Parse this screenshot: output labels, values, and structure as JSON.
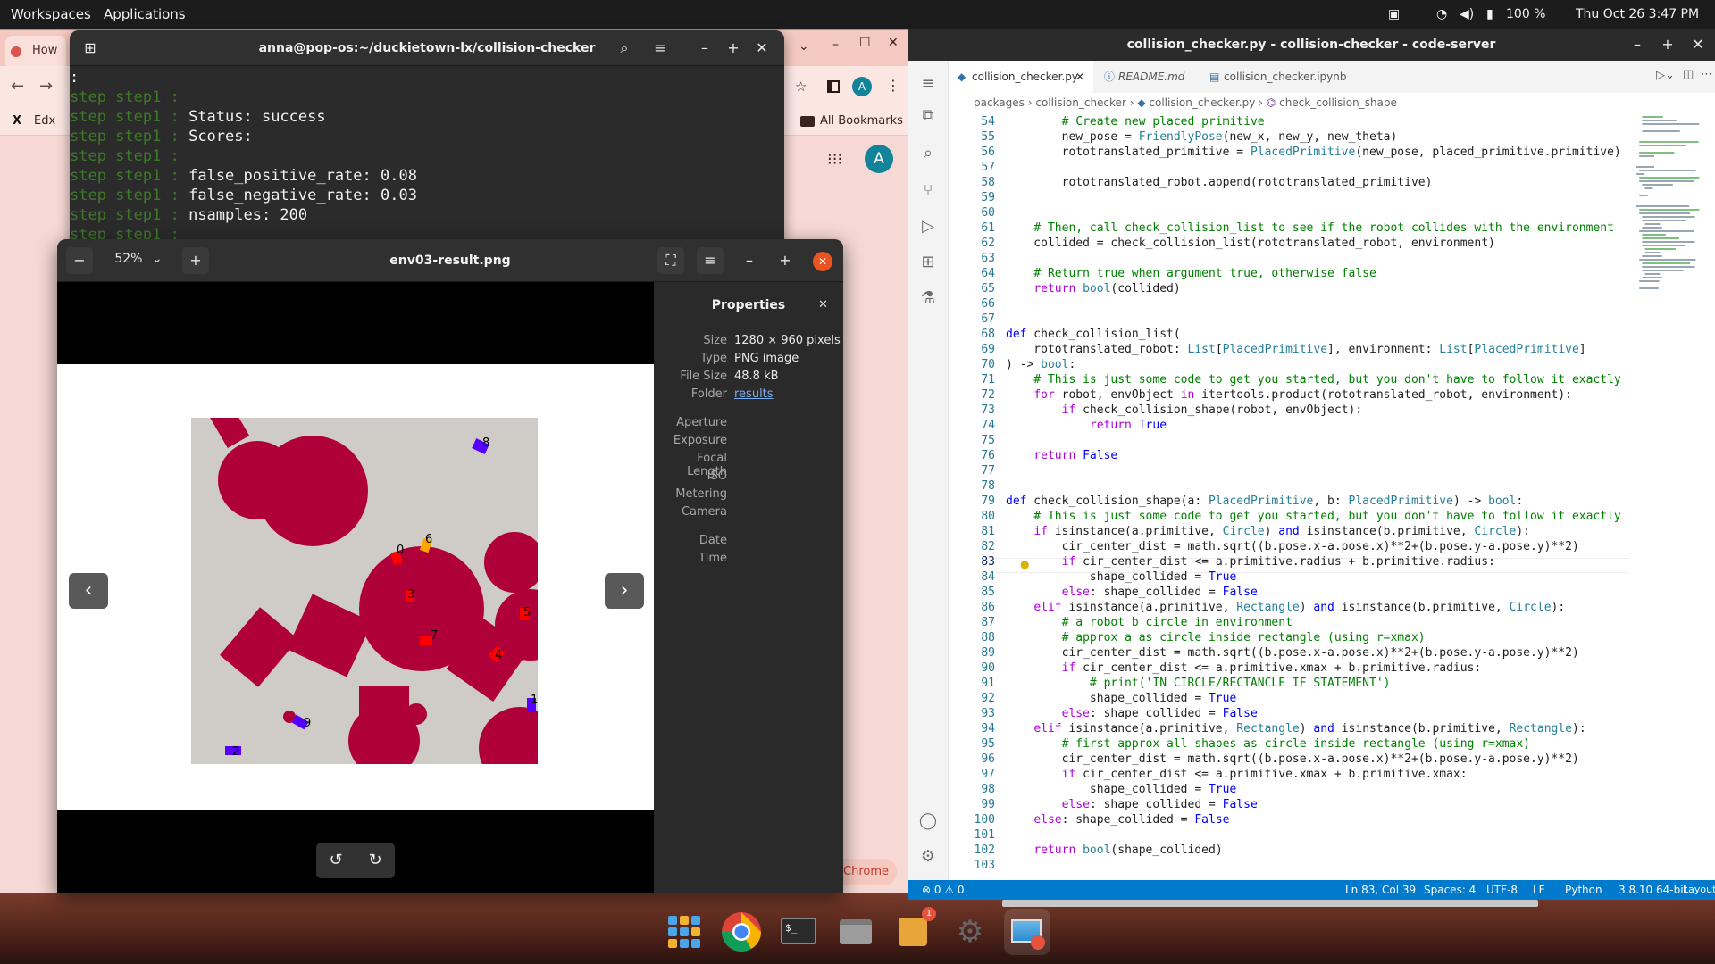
{
  "topbar": {
    "workspaces": "Workspaces",
    "applications": "Applications",
    "battery": "100 %",
    "datetime": "Thu Oct 26  3:47 PM"
  },
  "chrome": {
    "tab_label": "How",
    "bookmark_edx": "Edx",
    "all_bookmarks": "All Bookmarks",
    "avatar_letter": "A",
    "chip_label": "Chrome"
  },
  "terminal": {
    "title": "anna@pop-os:~/duckietown-lx/collision-checker",
    "prefix": "step step1 :",
    "lines": [
      ":",
      "",
      "Status: success",
      "Scores:",
      "",
      "false_positive_rate: 0.08",
      "false_negative_rate: 0.03",
      "nsamples: 200",
      ""
    ]
  },
  "viewer": {
    "title": "env03-result.png",
    "zoom": "52%",
    "properties": {
      "heading": "Properties",
      "size_k": "Size",
      "size_v": "1280 × 960 pixels",
      "type_k": "Type",
      "type_v": "PNG image",
      "filesize_k": "File Size",
      "filesize_v": "48.8 kB",
      "folder_k": "Folder",
      "folder_v": "results",
      "aperture_k": "Aperture",
      "exposure_k": "Exposure",
      "focal_k": "Focal Length",
      "iso_k": "ISO",
      "metering_k": "Metering",
      "camera_k": "Camera",
      "date_k": "Date",
      "time_k": "Time"
    },
    "image_labels": [
      "0",
      "6",
      "3",
      "5",
      "7",
      "4",
      "1",
      "9",
      "2",
      "8"
    ],
    "colors": {
      "obstacle": "#b0003a",
      "robot_red": "#ff0000",
      "robot_blue": "#5500ff",
      "robot_orange": "#ffa500",
      "arena": "#cfcbc6"
    }
  },
  "code": {
    "window_title": "collision_checker.py - collision-checker - code-server",
    "tabs": [
      {
        "label": "collision_checker.py"
      },
      {
        "label": "README.md"
      },
      {
        "label": "collision_checker.ipynb"
      }
    ],
    "breadcrumb": {
      "p1": "packages",
      "p2": "collision_checker",
      "p3": "collision_checker.py",
      "p4": "check_collision_shape"
    },
    "lines": [
      {
        "n": "54",
        "t": "        # Create new placed primitive"
      },
      {
        "n": "55",
        "t": "        new_pose = FriendlyPose(new_x, new_y, new_theta)"
      },
      {
        "n": "56",
        "t": "        rototranslated_primitive = PlacedPrimitive(new_pose, placed_primitive.primitive)"
      },
      {
        "n": "57",
        "t": ""
      },
      {
        "n": "58",
        "t": "        rototranslated_robot.append(rototranslated_primitive)"
      },
      {
        "n": "59",
        "t": ""
      },
      {
        "n": "60",
        "t": ""
      },
      {
        "n": "61",
        "t": "    # Then, call check_collision_list to see if the robot collides with the environment"
      },
      {
        "n": "62",
        "t": "    collided = check_collision_list(rototranslated_robot, environment)"
      },
      {
        "n": "63",
        "t": ""
      },
      {
        "n": "64",
        "t": "    # Return true when argument true, otherwise false"
      },
      {
        "n": "65",
        "t": "    return bool(collided)"
      },
      {
        "n": "66",
        "t": ""
      },
      {
        "n": "67",
        "t": ""
      },
      {
        "n": "68",
        "t": "def check_collision_list("
      },
      {
        "n": "69",
        "t": "    rototranslated_robot: List[PlacedPrimitive], environment: List[PlacedPrimitive]"
      },
      {
        "n": "70",
        "t": ") -> bool:"
      },
      {
        "n": "71",
        "t": "    # This is just some code to get you started, but you don't have to follow it exactly"
      },
      {
        "n": "72",
        "t": "    for robot, envObject in itertools.product(rototranslated_robot, environment):"
      },
      {
        "n": "73",
        "t": "        if check_collision_shape(robot, envObject):"
      },
      {
        "n": "74",
        "t": "            return True"
      },
      {
        "n": "75",
        "t": ""
      },
      {
        "n": "76",
        "t": "    return False"
      },
      {
        "n": "77",
        "t": ""
      },
      {
        "n": "78",
        "t": ""
      },
      {
        "n": "79",
        "t": "def check_collision_shape(a: PlacedPrimitive, b: PlacedPrimitive) -> bool:"
      },
      {
        "n": "80",
        "t": "    # This is just some code to get you started, but you don't have to follow it exactly"
      },
      {
        "n": "81",
        "t": "    if isinstance(a.primitive, Circle) and isinstance(b.primitive, Circle):"
      },
      {
        "n": "82",
        "t": "        cir_center_dist = math.sqrt((b.pose.x-a.pose.x)**2+(b.pose.y-a.pose.y)**2)"
      },
      {
        "n": "83",
        "t": "        if cir_center_dist <= a.primitive.radius + b.primitive.radius:"
      },
      {
        "n": "84",
        "t": "            shape_collided = True"
      },
      {
        "n": "85",
        "t": "        else: shape_collided = False"
      },
      {
        "n": "86",
        "t": "    elif isinstance(a.primitive, Rectangle) and isinstance(b.primitive, Circle):"
      },
      {
        "n": "87",
        "t": "        # a robot b circle in environment"
      },
      {
        "n": "88",
        "t": "        # approx a as circle inside rectangle (using r=xmax)"
      },
      {
        "n": "89",
        "t": "        cir_center_dist = math.sqrt((b.pose.x-a.pose.x)**2+(b.pose.y-a.pose.y)**2)"
      },
      {
        "n": "90",
        "t": "        if cir_center_dist <= a.primitive.xmax + b.primitive.radius:"
      },
      {
        "n": "91",
        "t": "            # print('IN CIRCLE/RECTANCLE IF STATEMENT')"
      },
      {
        "n": "92",
        "t": "            shape_collided = True"
      },
      {
        "n": "93",
        "t": "        else: shape_collided = False"
      },
      {
        "n": "94",
        "t": "    elif isinstance(a.primitive, Rectangle) and isinstance(b.primitive, Rectangle):"
      },
      {
        "n": "95",
        "t": "        # first approx all shapes as circle inside rectangle (using r=xmax)"
      },
      {
        "n": "96",
        "t": "        cir_center_dist = math.sqrt((b.pose.x-a.pose.x)**2+(b.pose.y-a.pose.y)**2)"
      },
      {
        "n": "97",
        "t": "        if cir_center_dist <= a.primitive.xmax + b.primitive.xmax:"
      },
      {
        "n": "98",
        "t": "            shape_collided = True"
      },
      {
        "n": "99",
        "t": "        else: shape_collided = False"
      },
      {
        "n": "100",
        "t": "    else: shape_collided = False"
      },
      {
        "n": "101",
        "t": ""
      },
      {
        "n": "102",
        "t": "    return bool(shape_collided)"
      },
      {
        "n": "103",
        "t": ""
      }
    ],
    "current_line": "83",
    "status": {
      "problems": "⊗ 0 ⚠ 0",
      "cursor": "Ln 83, Col 39",
      "spaces": "Spaces: 4",
      "encoding": "UTF-8",
      "eol": "LF",
      "language": "Python",
      "interpreter": "3.8.10 64-bit",
      "layout": "Layout: us"
    }
  },
  "dock": {
    "badge": "1"
  }
}
